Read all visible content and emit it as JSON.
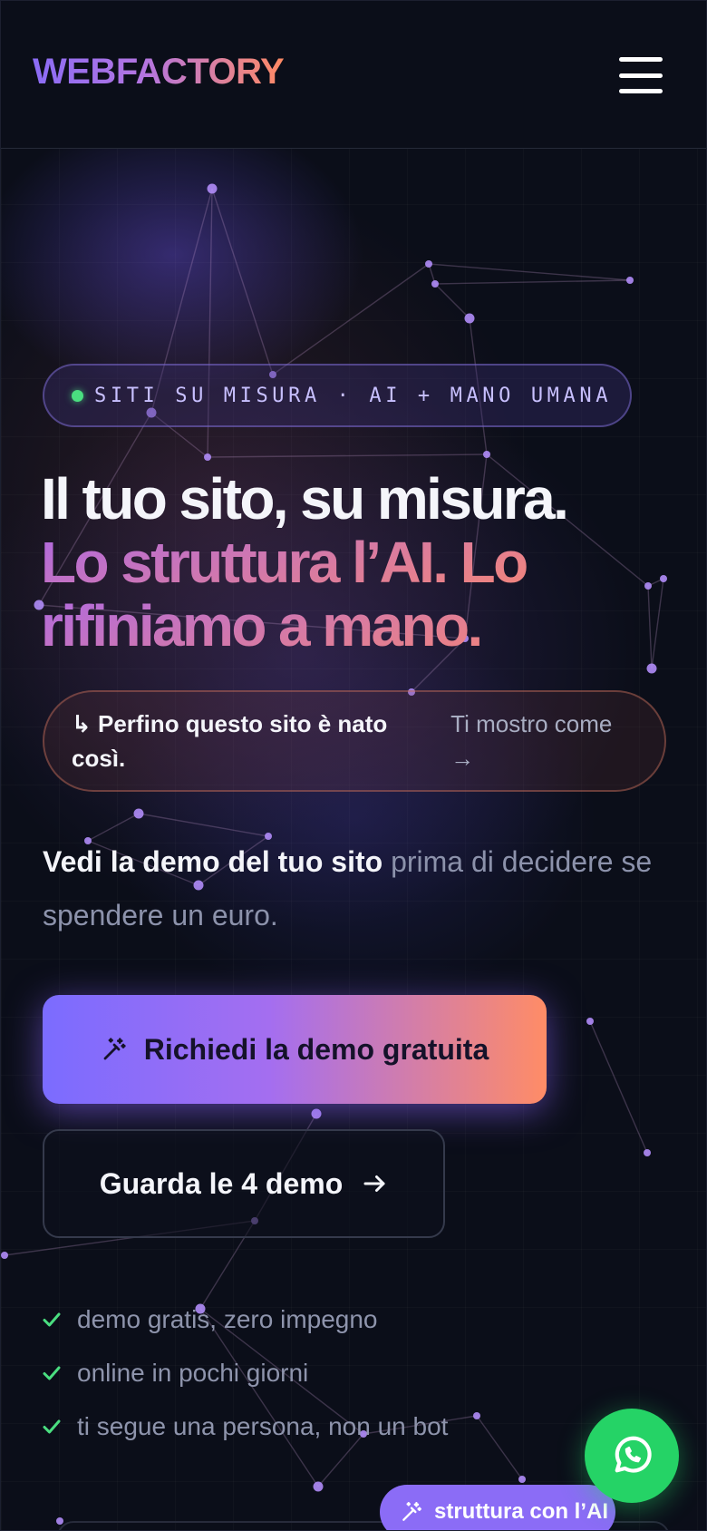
{
  "header": {
    "logo": "WEBFACTORY",
    "menu_icon": "hamburger-menu-icon"
  },
  "hero": {
    "badge": "SITI SU MISURA · AI + MANO UMANA",
    "headline_line1": "Il tuo sito, su misura.",
    "headline_line2": "Lo struttura l’AI. Lo",
    "headline_line3": "rifiniamo a mano.",
    "note_left": "↳ Perfino questo sito è nato così.",
    "note_right": "Ti mostro come →",
    "subtitle_strong": "Vedi la demo del tuo sito",
    "subtitle_rest": " prima di decidere se spendere un euro.",
    "cta_primary": "Richiedi la demo gratuita",
    "cta_primary_icon": "magic-wand-icon",
    "cta_secondary": "Guarda le 4 demo",
    "cta_secondary_icon": "arrow-right-icon",
    "checks": [
      "demo gratis, zero impegno",
      "online in pochi giorni",
      "ti segue una persona, non un bot"
    ],
    "check_icon": "check-icon"
  },
  "floating": {
    "ai_pill": "struttura con l’AI",
    "ai_pill_icon": "magic-wand-icon",
    "whatsapp_icon": "whatsapp-icon"
  },
  "colors": {
    "background": "#0b0e19",
    "accent_purple": "#8b6cf6",
    "accent_orange": "#ff8a64",
    "success_green": "#4ade80",
    "whatsapp_green": "#25d366"
  }
}
